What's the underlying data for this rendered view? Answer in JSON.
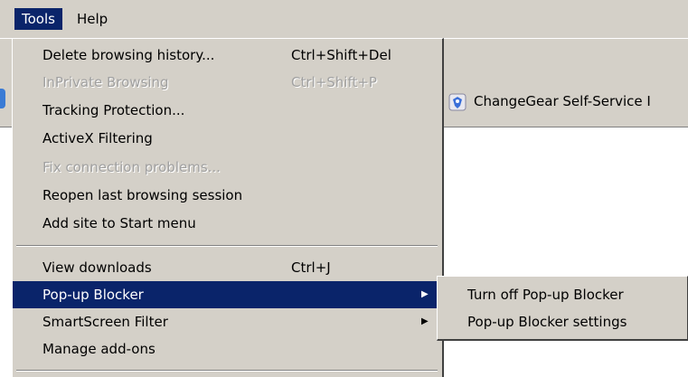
{
  "menubar": {
    "items": [
      {
        "label": "Tools"
      },
      {
        "label": "Help"
      }
    ]
  },
  "favorites_bar": {
    "item_label": "ChangeGear Self-Service I"
  },
  "tools_menu": {
    "items": [
      {
        "label": "Delete browsing history...",
        "shortcut": "Ctrl+Shift+Del"
      },
      {
        "label": "InPrivate Browsing",
        "shortcut": "Ctrl+Shift+P",
        "disabled": true
      },
      {
        "label": "Tracking Protection...",
        "shortcut": ""
      },
      {
        "label": "ActiveX Filtering",
        "shortcut": ""
      },
      {
        "label": "Fix connection problems...",
        "shortcut": "",
        "disabled": true
      },
      {
        "label": "Reopen last browsing session",
        "shortcut": ""
      },
      {
        "label": "Add site to Start menu",
        "shortcut": ""
      },
      {
        "label": "View downloads",
        "shortcut": "Ctrl+J"
      },
      {
        "label": "Pop-up Blocker",
        "shortcut": "",
        "submenu": true,
        "highlighted": true
      },
      {
        "label": "SmartScreen Filter",
        "shortcut": "",
        "submenu": true
      },
      {
        "label": "Manage add-ons",
        "shortcut": ""
      }
    ]
  },
  "popup_submenu": {
    "items": [
      {
        "label": "Turn off Pop-up Blocker"
      },
      {
        "label": "Pop-up Blocker settings"
      }
    ]
  },
  "colors": {
    "menu_bg": "#d4d0c8",
    "highlight_bg": "#0a246a",
    "highlight_fg": "#ffffff",
    "disabled_fg": "#a0a0a0"
  }
}
